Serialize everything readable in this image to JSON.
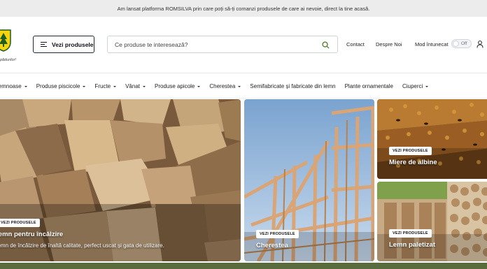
{
  "announcement": "Am lansat platforma ROMSILVA prin care poți să-ți comanzi produsele de care ai nevoie, direct la tine acasă.",
  "header": {
    "logo_slogan": "pădurilor!",
    "products_button": "Vezi produsele",
    "search_placeholder": "Ce produse te interesează?",
    "links": [
      "Contact",
      "Despre Noi"
    ],
    "dark_mode_label": "Mod întunecat",
    "dark_mode_state": "Off"
  },
  "categories": [
    {
      "label": "Produse lemnoase",
      "dropdown": true
    },
    {
      "label": "Produse piscicole",
      "dropdown": true
    },
    {
      "label": "Fructe",
      "dropdown": true
    },
    {
      "label": "Vânat",
      "dropdown": true
    },
    {
      "label": "Produse apicole",
      "dropdown": true
    },
    {
      "label": "Cherestea",
      "dropdown": true
    },
    {
      "label": "Semifabricate și fabricate din lemn",
      "dropdown": false
    },
    {
      "label": "Plante ornamentale",
      "dropdown": false
    },
    {
      "label": "Ciuperci",
      "dropdown": true
    }
  ],
  "cards": [
    {
      "badge": "VEZI PRODUSELE",
      "title": "Lemn pentru încălzire",
      "description": "Lemn de încălzire de înaltă calitate, perfect uscat și gata de utilizare."
    },
    {
      "badge": "VEZI PRODUSELE",
      "title": "Cherestea"
    },
    {
      "badge": "VEZI PRODUSELE",
      "title": "Miere de albine"
    },
    {
      "badge": "VEZI PRODUSELE",
      "title": "Lemn paletizat"
    }
  ],
  "colors": {
    "accent": "#1f2937",
    "logo_green": "#1f5d22",
    "logo_yellow": "#f5d40d"
  }
}
